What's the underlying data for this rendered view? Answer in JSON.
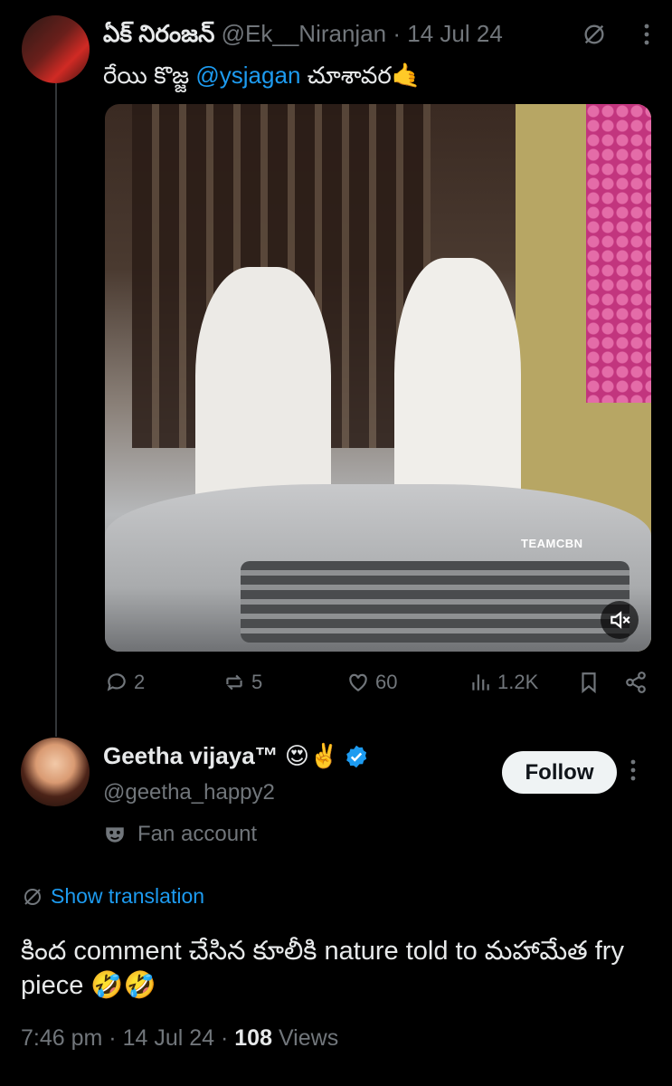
{
  "parent_tweet": {
    "display_name": "ఏక్ నిరంజన్",
    "handle": "@Ek__Niranjan",
    "separator": "·",
    "date": "14 Jul 24",
    "text_before": "రేయి కొజ్జ ",
    "mention": "@ysjagan",
    "text_after": " చూశావర🤙",
    "media": {
      "watermark": "TEAMCBN"
    },
    "actions": {
      "replies": "2",
      "reposts": "5",
      "likes": "60",
      "views": "1.2K"
    }
  },
  "reply": {
    "display_name": "Geetha vijaya™ 😍✌️",
    "handle": "@geetha_happy2",
    "follow_label": "Follow",
    "badge_label": "Fan account",
    "show_translation": "Show translation",
    "text": "కింద comment చేసిన కూలీకి nature told to మహామేత fry piece 🤣🤣",
    "time": "7:46 pm",
    "date": "14 Jul 24",
    "views_count": "108",
    "views_label": "Views"
  },
  "colors": {
    "accent": "#1d9bf0",
    "muted": "#71767b",
    "bg": "#000000"
  }
}
